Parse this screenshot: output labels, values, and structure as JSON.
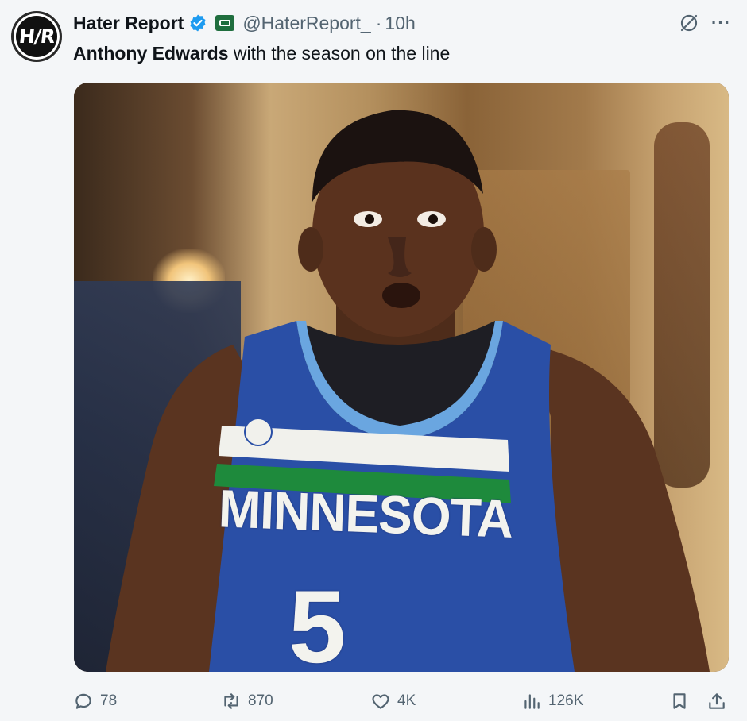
{
  "author": {
    "display_name": "Hater Report",
    "handle": "@HaterReport_",
    "time": "10h",
    "avatar_text": "H/R"
  },
  "tweet": {
    "text_bold": "Anthony Edwards",
    "text_rest": " with the season on the line"
  },
  "media": {
    "jersey_text": "MINNESOTA",
    "jersey_number": "5"
  },
  "actions": {
    "replies": "78",
    "reposts": "870",
    "likes": "4K",
    "views": "126K"
  },
  "colors": {
    "verified": "#1d9bf0",
    "affiliate_badge": "#1f6e3e",
    "secondary_text": "#536471",
    "jersey_blue": "#2a4fa6",
    "jersey_green": "#1e8a3c"
  }
}
